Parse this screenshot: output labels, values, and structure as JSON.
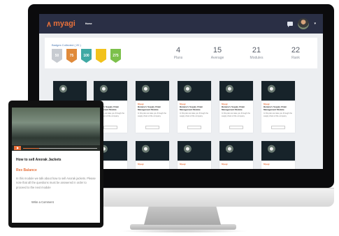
{
  "header": {
    "logo": "myagi",
    "nav_link": "Home"
  },
  "badges": {
    "title": "Badges Collected ( 20 )",
    "items": [
      {
        "value": "50",
        "color": "#c7cbd1"
      },
      {
        "value": "75",
        "color": "#e08a3a"
      },
      {
        "value": "100",
        "color": "#3fa9a4"
      },
      {
        "value": "",
        "color": "#f2c21b"
      },
      {
        "value": "275",
        "color": "#7cc04b"
      }
    ]
  },
  "stats": [
    {
      "value": "4",
      "label": "Plans"
    },
    {
      "value": "15",
      "label": "Average"
    },
    {
      "value": "21",
      "label": "Modules"
    },
    {
      "value": "22",
      "label": "Rank"
    }
  ],
  "cards": [
    {
      "tag": "Myagi",
      "title": "Banana's Supply Chain Management Module",
      "desc": "In this plan we take you through the supply chain of the company"
    },
    {
      "tag": "Myagi",
      "title": "Banana's Supply Chain Management Module",
      "desc": "In this plan we take you through the supply chain of the company"
    },
    {
      "tag": "Myagi",
      "title": "Banana's Supply Chain Management Module",
      "desc": "In this plan we take you through the supply chain of the company"
    },
    {
      "tag": "Myagi",
      "title": "Banana's Supply Chain Management Module",
      "desc": "In this plan we take you through the supply chain of the company"
    },
    {
      "tag": "Myagi",
      "title": "Banana's Supply Chain Management Module",
      "desc": "In this plan we take you through the supply chain of the company"
    },
    {
      "tag": "Myagi",
      "title": "",
      "desc": ""
    },
    {
      "tag": "Myagi",
      "title": "",
      "desc": ""
    },
    {
      "tag": "Myagi",
      "title": "",
      "desc": ""
    },
    {
      "tag": "Myagi",
      "title": "",
      "desc": ""
    },
    {
      "tag": "Myagi",
      "title": "",
      "desc": ""
    }
  ],
  "tablet": {
    "title": "How to sell Anorak Jackets",
    "tag": "Rex Balance",
    "body": "In this module we talk about how to sell Anorak jackets. Please note that all the questions must be answered in order to proceed to the next module",
    "comment_label": "Write a Comment",
    "progress": 0.22
  },
  "colors": {
    "accent": "#e7703a",
    "topbar": "#2a2f45"
  }
}
